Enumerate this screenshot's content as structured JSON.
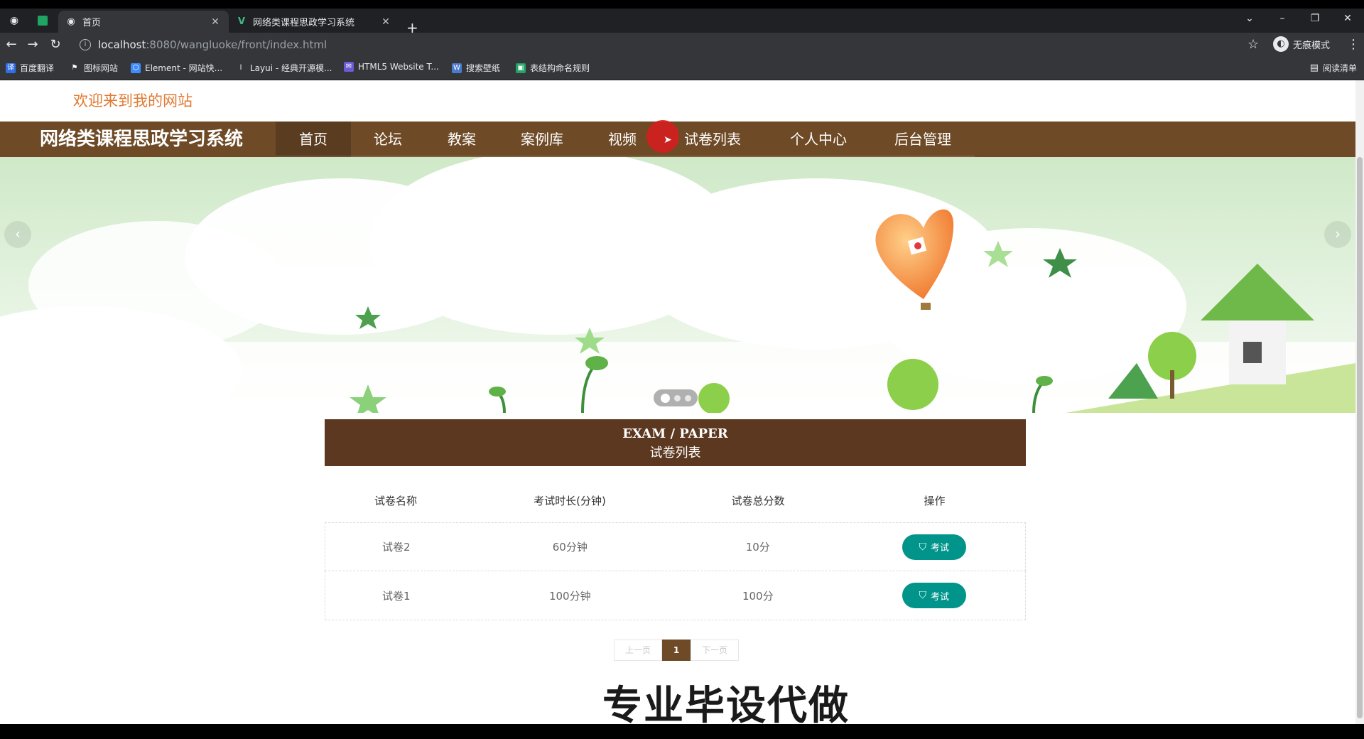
{
  "browser": {
    "tabs": [
      {
        "title": "首页",
        "active": true
      },
      {
        "title": "网络类课程思政学习系统",
        "active": false
      }
    ],
    "address": {
      "host": "localhost",
      "path": ":8080/wangluoke/front/index.html"
    },
    "profile_label": "无痕模式",
    "bookmarks": [
      {
        "label": "百度翻译",
        "color": "#2f6fe8",
        "glyph": "译"
      },
      {
        "label": "图标网站",
        "color": "#35363a",
        "glyph": "⚑"
      },
      {
        "label": "Element - 网站快...",
        "color": "#3f8cff",
        "glyph": "⬡"
      },
      {
        "label": "Layui - 经典开源模...",
        "color": "#35363a",
        "glyph": "l"
      },
      {
        "label": "HTML5 Website T...",
        "color": "#6b5bd6",
        "glyph": "✉"
      },
      {
        "label": "搜索壁纸",
        "color": "#4a7bd0",
        "glyph": "W"
      },
      {
        "label": "表结构命名规则",
        "color": "#1fa463",
        "glyph": "▣"
      }
    ],
    "reading_list": "阅读清单"
  },
  "site": {
    "welcome": "欢迎来到我的网站",
    "brand": "网络类课程思政学习系统",
    "nav": [
      "首页",
      "论坛",
      "教案",
      "案例库",
      "视频",
      "试卷列表",
      "个人中心",
      "后台管理"
    ],
    "active_nav": "首页"
  },
  "banner": {
    "prev": "‹",
    "next": "›",
    "dot_count": 3,
    "active_dot": 0
  },
  "section": {
    "title_en": "EXAM / PAPER",
    "title_cn": "试卷列表"
  },
  "table": {
    "headers": [
      "试卷名称",
      "考试时长(分钟)",
      "试卷总分数",
      "操作"
    ],
    "rows": [
      {
        "name": "试卷2",
        "duration": "60分钟",
        "score": "10分",
        "action": "考试"
      },
      {
        "name": "试卷1",
        "duration": "100分钟",
        "score": "100分",
        "action": "考试"
      }
    ]
  },
  "pager": {
    "prev": "上一页",
    "current": "1",
    "next": "下一页"
  },
  "watermark": "专业毕设代做",
  "colors": {
    "nav_brown": "#6e4a26",
    "head_brown": "#5c3820",
    "teal": "#00948a",
    "welcome_orange": "#e07a32"
  }
}
